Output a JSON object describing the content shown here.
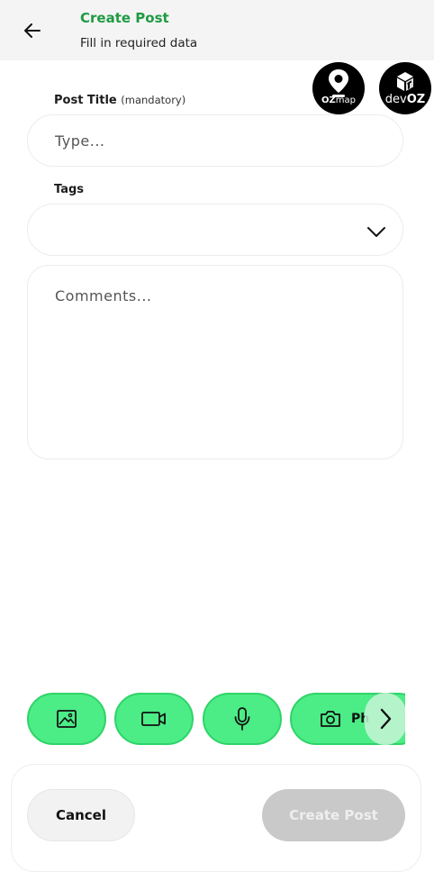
{
  "header": {
    "title": "Create Post",
    "subtitle": "Fill in required data"
  },
  "badges": {
    "ozmap": {
      "bold": "OZ",
      "light": "map"
    },
    "devoz": {
      "light": "dev",
      "bold": "OZ"
    }
  },
  "form": {
    "post_title_label": "Post Title",
    "post_title_hint": "(mandatory)",
    "post_title_placeholder": "Type...",
    "post_title_value": "",
    "tags_label": "Tags",
    "tags_value": "",
    "comments_placeholder": "Comments...",
    "comments_value": ""
  },
  "media": {
    "photo_label": "Ph"
  },
  "footer": {
    "cancel_label": "Cancel",
    "create_label": "Create Post"
  },
  "colors": {
    "accent": "#1f9a44",
    "media_button": "#4cec86",
    "disabled_button": "#c9c9c9"
  },
  "icons": [
    "arrow-left-icon",
    "location-pin-icon",
    "box-icon",
    "chevron-down-icon",
    "image-icon",
    "video-icon",
    "microphone-icon",
    "camera-icon",
    "chevron-right-icon"
  ]
}
